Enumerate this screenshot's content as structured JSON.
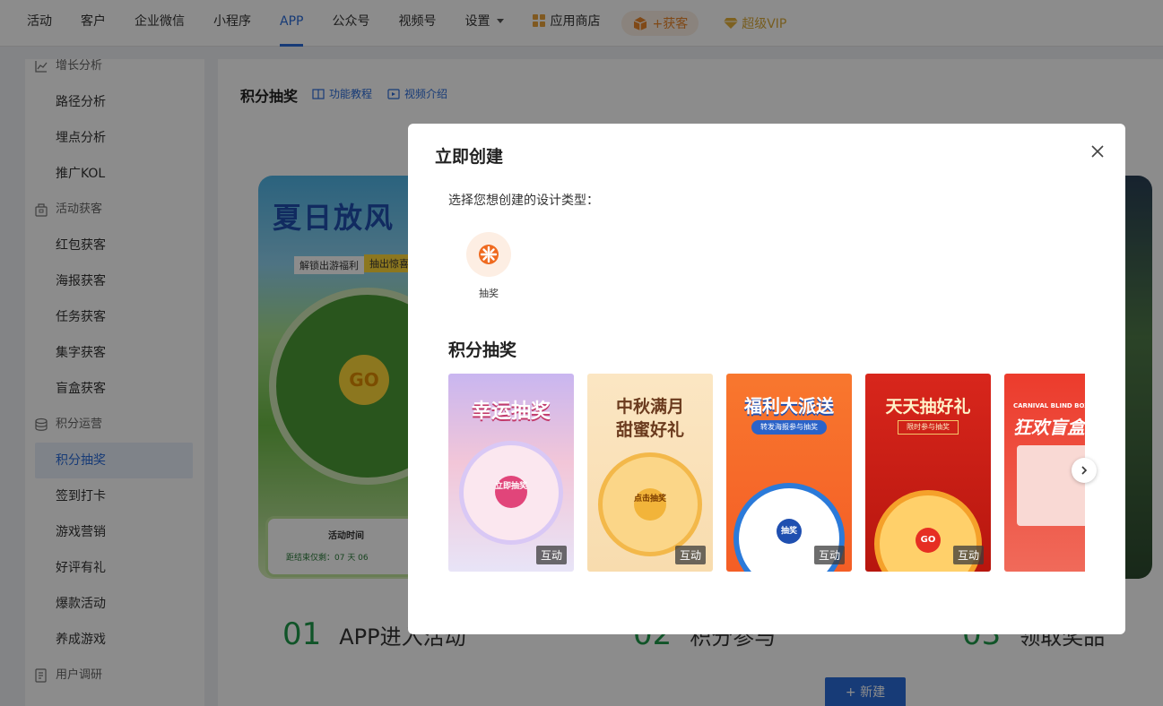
{
  "nav": {
    "items": [
      "活动",
      "客户",
      "企业微信",
      "小程序",
      "APP",
      "公众号",
      "视频号",
      "设置"
    ],
    "active": "APP",
    "app_store": "应用商店",
    "fans": "+获客",
    "vip": "超级VIP"
  },
  "sidebar": {
    "groups": [
      {
        "label": "增长分析",
        "icon": "chart-icon",
        "items": [
          "路径分析",
          "埋点分析",
          "推广KOL"
        ]
      },
      {
        "label": "活动获客",
        "icon": "gift-icon",
        "items": [
          "红包获客",
          "海报获客",
          "任务获客",
          "集字获客",
          "盲盒获客"
        ]
      },
      {
        "label": "积分运营",
        "icon": "database-icon",
        "items": [
          "积分抽奖",
          "签到打卡",
          "游戏营销",
          "好评有礼",
          "爆款活动",
          "养成游戏"
        ]
      },
      {
        "label": "用户调研",
        "icon": "survey-icon",
        "items": []
      }
    ],
    "active": "积分抽奖"
  },
  "main": {
    "title": "积分抽奖",
    "tutorial": "功能教程",
    "video": "视频介绍",
    "steps": [
      {
        "num": "01",
        "text": "APP进入活动"
      },
      {
        "num": "02",
        "text": "积分参与"
      },
      {
        "num": "03",
        "text": "领取奖品"
      }
    ],
    "new_button": "+ 新建",
    "poster": {
      "title": "夏日放风",
      "sub1": "解锁出游福利",
      "sub2": "抽出惊喜",
      "go": "GO",
      "card_title": "活动时间",
      "card_sub": "距结束仅剩：07 天 06"
    }
  },
  "modal": {
    "title": "立即创建",
    "prompt": "选择您想创建的设计类型：",
    "type_label": "抽奖",
    "section_title": "积分抽奖",
    "templates": [
      {
        "title": "幸运抽奖",
        "hub": "立即抽奖",
        "badge": "互动",
        "bg": "#e9d6f2"
      },
      {
        "title": "中秋满月 甜蜜好礼",
        "hub": "点击抽奖",
        "badge": "互动",
        "bg": "#f9e2bd"
      },
      {
        "title": "福利大派送",
        "sub": "转发海报参与抽奖",
        "hub": "抽奖",
        "badge": "互动",
        "bg": "#f46a2a"
      },
      {
        "title": "天天抽好礼",
        "sub": "限时参与抽奖",
        "hub": "GO",
        "badge": "互动",
        "bg": "#d9261c"
      },
      {
        "title": "狂欢盲盒",
        "sub": "CARNIVAL BLIND BOX",
        "badge": "",
        "bg": "#e8372a"
      }
    ]
  }
}
